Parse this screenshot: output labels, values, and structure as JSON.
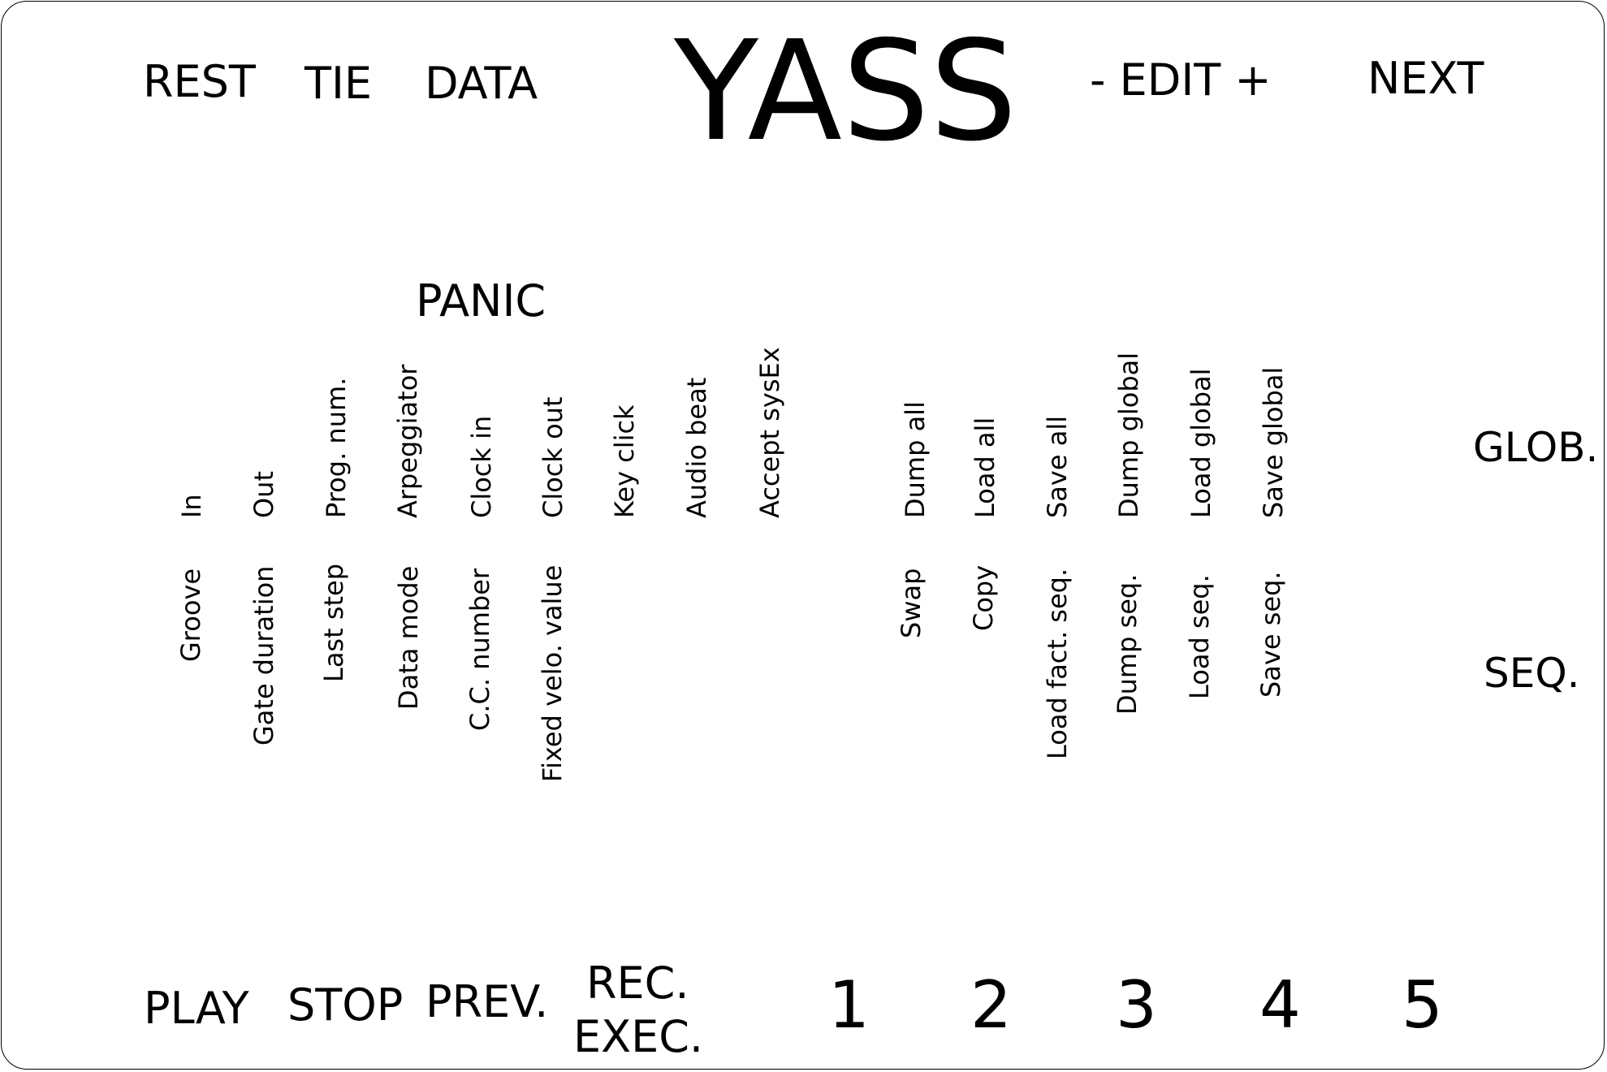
{
  "title": "YASS",
  "top_buttons": {
    "rest": "REST",
    "tie": "TIE",
    "data": "DATA",
    "edit": "- EDIT +",
    "next": "NEXT"
  },
  "panic": "PANIC",
  "row_labels": {
    "glob": "GLOB.",
    "seq": "SEQ."
  },
  "glob_labels": [
    "In",
    "Out",
    "Prog. num.",
    "Arpeggiator",
    "Clock in",
    "Clock out",
    "Key click",
    "Audio beat",
    "Accept sysEx",
    "Dump all",
    "Load all",
    "Save all",
    "Dump global",
    "Load global",
    "Save global"
  ],
  "seq_labels": [
    "Groove",
    "Gate duration",
    "Last step",
    "Data mode",
    "C.C. number",
    "Fixed velo. value",
    "Swap",
    "Copy",
    "Load fact. seq.",
    "Dump seq.",
    "Load seq.",
    "Save seq."
  ],
  "bottom_buttons": {
    "play": "PLAY",
    "stop": "STOP",
    "prev": "PREV.",
    "rec": "REC.",
    "exec": "EXEC.",
    "n1": "1",
    "n2": "2",
    "n3": "3",
    "n4": "4",
    "n5": "5"
  }
}
